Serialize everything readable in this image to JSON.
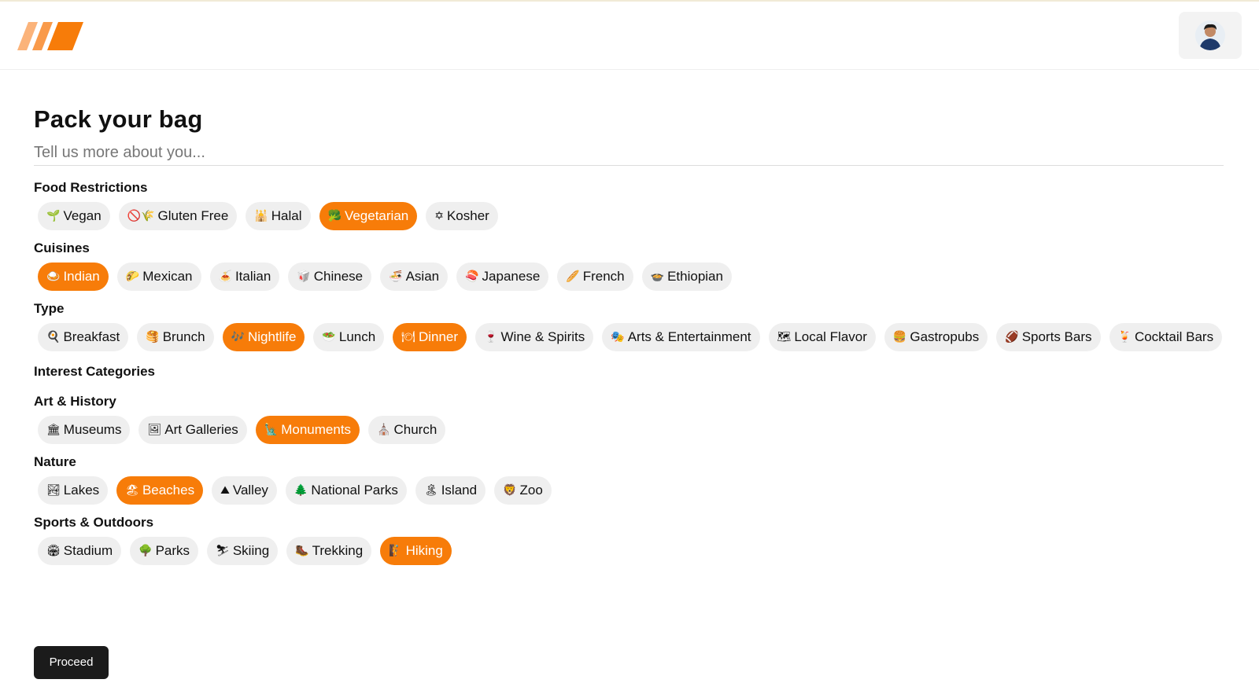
{
  "header": {
    "logo": "stripes-logo",
    "accent_color": "#f77c09",
    "avatar": "user-avatar"
  },
  "page": {
    "title": "Pack your bag",
    "about_placeholder": "Tell us more about you..."
  },
  "sections": {
    "food": {
      "title": "Food Restrictions",
      "chips": [
        {
          "icon": "🌱",
          "label": "Vegan",
          "selected": false
        },
        {
          "icon": "🚫🌾",
          "label": "Gluten Free",
          "selected": false
        },
        {
          "icon": "🕌",
          "label": "Halal",
          "selected": false
        },
        {
          "icon": "🥦",
          "label": "Vegetarian",
          "selected": true
        },
        {
          "icon": "✡",
          "label": "Kosher",
          "selected": false
        }
      ]
    },
    "cuisines": {
      "title": "Cuisines",
      "chips": [
        {
          "icon": "🍛",
          "label": "Indian",
          "selected": true
        },
        {
          "icon": "🌮",
          "label": "Mexican",
          "selected": false
        },
        {
          "icon": "🍝",
          "label": "Italian",
          "selected": false
        },
        {
          "icon": "🥡",
          "label": "Chinese",
          "selected": false
        },
        {
          "icon": "🍜",
          "label": "Asian",
          "selected": false
        },
        {
          "icon": "🍣",
          "label": "Japanese",
          "selected": false
        },
        {
          "icon": "🥖",
          "label": "French",
          "selected": false
        },
        {
          "icon": "🍲",
          "label": "Ethiopian",
          "selected": false
        }
      ]
    },
    "type": {
      "title": "Type",
      "chips": [
        {
          "icon": "🍳",
          "label": "Breakfast",
          "selected": false
        },
        {
          "icon": "🥞",
          "label": "Brunch",
          "selected": false
        },
        {
          "icon": "🎶",
          "label": "Nightlife",
          "selected": true
        },
        {
          "icon": "🥗",
          "label": "Lunch",
          "selected": false
        },
        {
          "icon": "🍽",
          "label": "Dinner",
          "selected": true
        },
        {
          "icon": "🍷",
          "label": "Wine & Spirits",
          "selected": false
        },
        {
          "icon": "🎭",
          "label": "Arts & Entertainment",
          "selected": false
        },
        {
          "icon": "🗺",
          "label": "Local Flavor",
          "selected": false
        },
        {
          "icon": "🍔",
          "label": "Gastropubs",
          "selected": false
        },
        {
          "icon": "🏈",
          "label": "Sports Bars",
          "selected": false
        },
        {
          "icon": "🍹",
          "label": "Cocktail Bars",
          "selected": false
        }
      ]
    },
    "interest": {
      "title": "Interest Categories"
    },
    "art": {
      "title": "Art & History",
      "chips": [
        {
          "icon": "🏛",
          "label": "Museums",
          "selected": false
        },
        {
          "icon": "🖼",
          "label": "Art Galleries",
          "selected": false
        },
        {
          "icon": "🗽",
          "label": "Monuments",
          "selected": true
        },
        {
          "icon": "⛪",
          "label": "Church",
          "selected": false
        }
      ]
    },
    "nature": {
      "title": "Nature",
      "chips": [
        {
          "icon": "🏞",
          "label": "Lakes",
          "selected": false
        },
        {
          "icon": "🏖",
          "label": "Beaches",
          "selected": true
        },
        {
          "icon": "⛰",
          "label": "Valley",
          "selected": false
        },
        {
          "icon": "🌲",
          "label": "National Parks",
          "selected": false
        },
        {
          "icon": "🏝",
          "label": "Island",
          "selected": false
        },
        {
          "icon": "🦁",
          "label": "Zoo",
          "selected": false
        }
      ]
    },
    "sports": {
      "title": "Sports & Outdoors",
      "chips": [
        {
          "icon": "🏟",
          "label": "Stadium",
          "selected": false
        },
        {
          "icon": "🌳",
          "label": "Parks",
          "selected": false
        },
        {
          "icon": "⛷",
          "label": "Skiing",
          "selected": false
        },
        {
          "icon": "🥾",
          "label": "Trekking",
          "selected": false
        },
        {
          "icon": "🧗",
          "label": "Hiking",
          "selected": true
        }
      ]
    }
  },
  "actions": {
    "proceed_label": "Proceed"
  }
}
